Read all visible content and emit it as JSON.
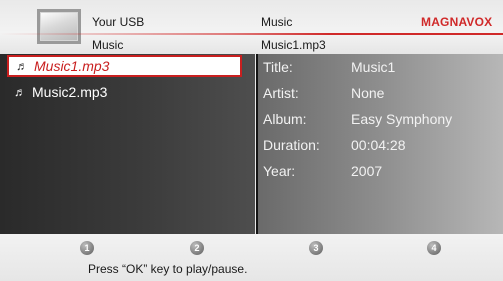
{
  "header": {
    "source": "Your USB",
    "category": "Music",
    "brand": "MAGNAVOX",
    "folder": "Music",
    "file": "Music1.mp3"
  },
  "colors": {
    "accent": "#d02929",
    "brand": "#d02929",
    "selection_border": "#c91f1f"
  },
  "list": {
    "items": [
      {
        "label": "Music1.mp3",
        "icon": "music-note-icon",
        "selected": true
      },
      {
        "label": "Music2.mp3",
        "icon": "music-note-icon",
        "selected": false
      }
    ]
  },
  "details": [
    {
      "key": "Title:",
      "value": "Music1"
    },
    {
      "key": "Artist:",
      "value": "None"
    },
    {
      "key": "Album:",
      "value": "Easy Symphony"
    },
    {
      "key": "Duration:",
      "value": "00:04:28"
    },
    {
      "key": "Year:",
      "value": "2007"
    }
  ],
  "footer": {
    "buttons": [
      "1",
      "2",
      "3",
      "4"
    ],
    "hint": "Press “OK” key to play/pause."
  },
  "icons": {
    "note_glyph": "♬"
  }
}
